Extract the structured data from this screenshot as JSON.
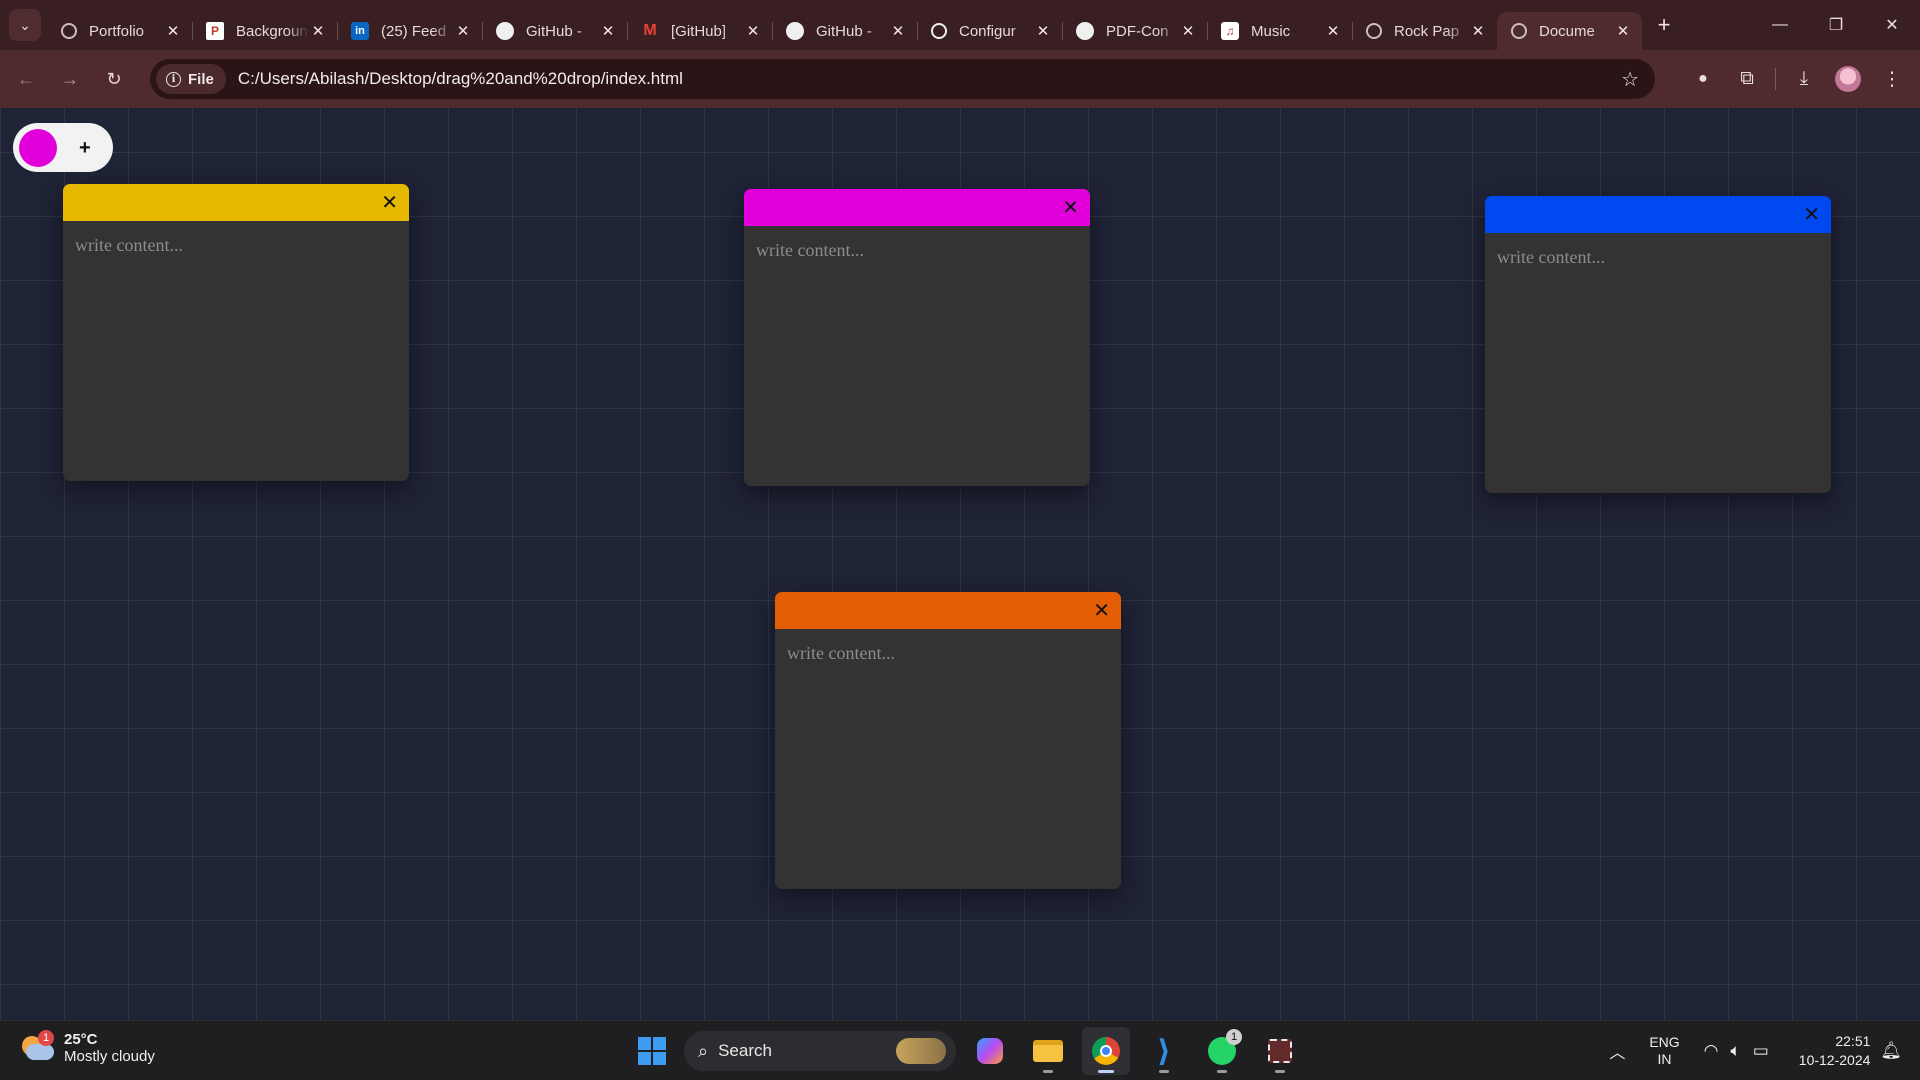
{
  "browser": {
    "tabs": [
      {
        "title": "Portfolio",
        "icon": "globe-icon"
      },
      {
        "title": "Background",
        "icon": "p-logo-icon"
      },
      {
        "title": "(25) Feed",
        "icon": "linkedin-icon"
      },
      {
        "title": "GitHub - ",
        "icon": "github-icon"
      },
      {
        "title": "[GitHub]",
        "icon": "gmail-icon"
      },
      {
        "title": "GitHub - ",
        "icon": "github-icon"
      },
      {
        "title": "Configur",
        "icon": "github-icon"
      },
      {
        "title": "PDF-Con",
        "icon": "github-icon"
      },
      {
        "title": "Music",
        "icon": "music-icon"
      },
      {
        "title": "Rock Pap",
        "icon": "globe-icon"
      },
      {
        "title": "Docume",
        "icon": "globe-icon",
        "active": true
      }
    ],
    "new_tab_label": "+",
    "site_chip": "File",
    "url": "C:/Users/Abilash/Desktop/drag%20and%20drop/index.html"
  },
  "controls": {
    "selected_color": "#e100d9",
    "add_label": "+"
  },
  "notes": [
    {
      "color": "#e6b900",
      "placeholder": "write content..."
    },
    {
      "color": "#e100d9",
      "placeholder": "write content..."
    },
    {
      "color": "#0049f0",
      "placeholder": "write content..."
    },
    {
      "color": "#e55e05",
      "placeholder": "write content..."
    }
  ],
  "note_close_label": "✕",
  "taskbar": {
    "weather_temp": "25°C",
    "weather_desc": "Mostly cloudy",
    "weather_badge": "1",
    "search_label": "Search",
    "whatsapp_badge": "1",
    "lang_line1": "ENG",
    "lang_line2": "IN",
    "time": "22:51",
    "date": "10-12-2024"
  }
}
